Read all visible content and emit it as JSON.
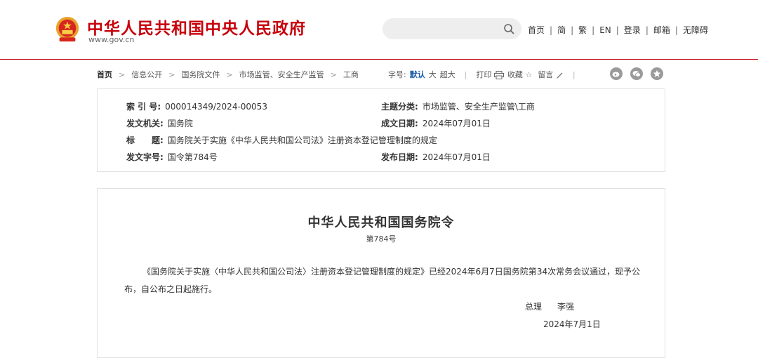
{
  "header": {
    "site_title": "中华人民共和国中央人民政府",
    "site_domain": "www.gov.cn",
    "search_placeholder": "",
    "nav": [
      "首页",
      "简",
      "繁",
      "EN",
      "登录",
      "邮箱",
      "无障碍"
    ],
    "accent_color": "#c7000b"
  },
  "breadcrumb": {
    "items": [
      "首页",
      "信息公开",
      "国务院文件",
      "市场监管、安全生产监管",
      "工商"
    ]
  },
  "toolbar": {
    "font_size_label": "字号:",
    "font_default": "默认",
    "font_large": "大",
    "font_xlarge": "超大",
    "print": "打印",
    "favorite": "收藏",
    "comment": "留言",
    "share_icons": [
      "weibo-icon",
      "wechat-icon",
      "star-icon"
    ]
  },
  "meta": {
    "index_label": "索 引 号:",
    "index_value": "000014349/2024-00053",
    "category_label": "主题分类:",
    "category_value": "市场监管、安全生产监管\\工商",
    "issuer_label": "发文机关:",
    "issuer_value": "国务院",
    "created_label": "成文日期:",
    "created_value": "2024年07月01日",
    "title_label": "标　　题:",
    "title_value": "国务院关于实施《中华人民共和国公司法》注册资本登记管理制度的规定",
    "docno_label": "发文字号:",
    "docno_value": "国令第784号",
    "published_label": "发布日期:",
    "published_value": "2024年07月01日"
  },
  "article": {
    "title": "中华人民共和国国务院令",
    "number": "第784号",
    "paragraph": "《国务院关于实施〈中华人民共和国公司法〉注册资本登记管理制度的规定》已经2024年6月7日国务院第34次常务会议通过，现予公布，自公布之日起施行。",
    "signer_title": "总理",
    "signer_name": "李强",
    "date": "2024年7月1日"
  }
}
